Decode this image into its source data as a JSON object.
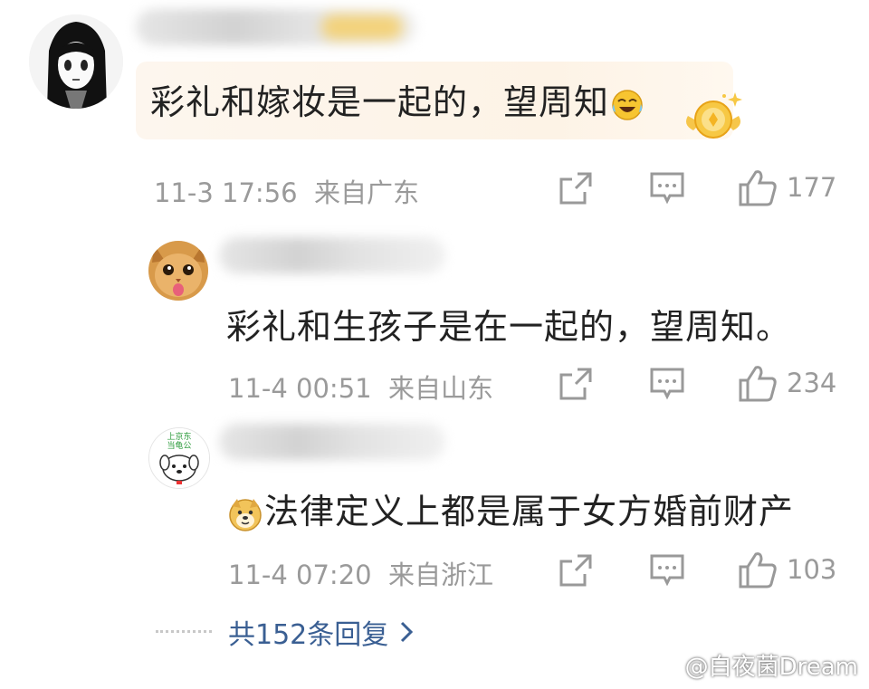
{
  "comments": [
    {
      "text": "彩礼和嫁妆是一起的，望周知",
      "emoji": "laughing-crying-emoji",
      "time": "11-3 17:56",
      "location": "来自广东",
      "likes": "177"
    },
    {
      "text": "彩礼和生孩子是在一起的，望周知。",
      "time": "11-4 00:51",
      "location": "来自山东",
      "likes": "234"
    },
    {
      "text": "法律定义上都是属于女方婚前财产",
      "emoji": "doge-emoji",
      "avatar_text": "上京东\n当龟公",
      "time": "11-4 07:20",
      "location": "来自浙江",
      "likes": "103"
    }
  ],
  "replies_link": "共152条回复",
  "watermark": "@白夜菌Dream",
  "colors": {
    "meta": "#9a9a9a",
    "link": "#3a5f93",
    "text": "#222222"
  }
}
